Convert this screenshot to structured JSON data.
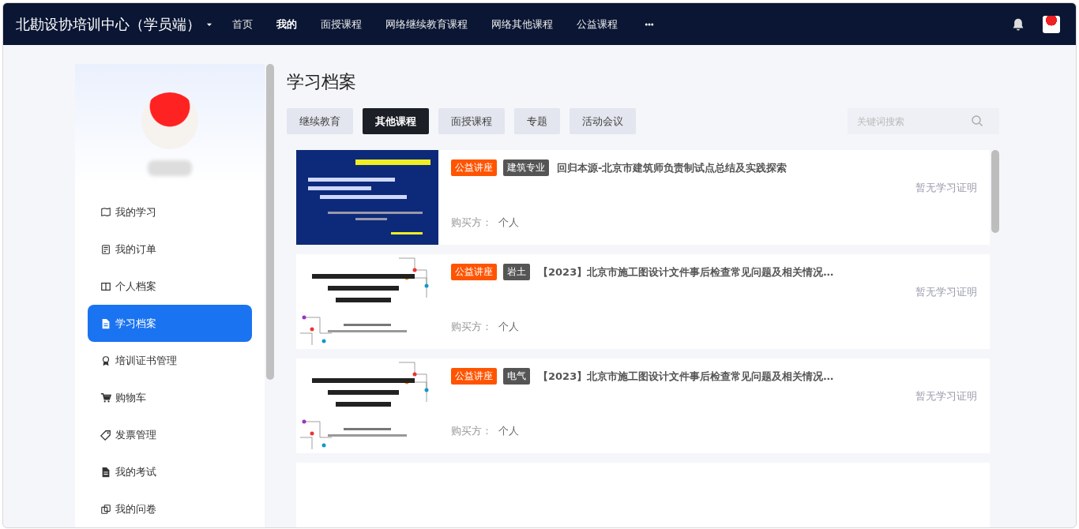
{
  "header": {
    "title": "北勘设协培训中心（学员端）",
    "nav": [
      {
        "label": "首页",
        "selected": false
      },
      {
        "label": "我的",
        "selected": true
      },
      {
        "label": "面授课程",
        "selected": false
      },
      {
        "label": "网络继续教育课程",
        "selected": false
      },
      {
        "label": "网络其他课程",
        "selected": false
      },
      {
        "label": "公益课程",
        "selected": false
      }
    ]
  },
  "sidebar": {
    "items": [
      {
        "label": "我的学习",
        "kind": "map",
        "selected": false
      },
      {
        "label": "我的订单",
        "kind": "order",
        "selected": false
      },
      {
        "label": "个人档案",
        "kind": "book",
        "selected": false
      },
      {
        "label": "学习档案",
        "kind": "file",
        "selected": true
      },
      {
        "label": "培训证书管理",
        "kind": "award",
        "selected": false
      },
      {
        "label": "购物车",
        "kind": "cart",
        "selected": false
      },
      {
        "label": "发票管理",
        "kind": "ticket",
        "selected": false
      },
      {
        "label": "我的考试",
        "kind": "file",
        "selected": false
      },
      {
        "label": "我的问卷",
        "kind": "copy",
        "selected": false
      }
    ]
  },
  "main": {
    "title": "学习档案",
    "tabs": [
      {
        "label": "继续教育",
        "selected": false
      },
      {
        "label": "其他课程",
        "selected": true
      },
      {
        "label": "面授课程",
        "selected": false
      },
      {
        "label": "专题",
        "selected": false
      },
      {
        "label": "活动会议",
        "selected": false
      }
    ],
    "search": {
      "placeholder": "关键词搜索"
    },
    "records": [
      {
        "tags": [
          {
            "label": "公益讲座",
            "color": "#ff5400"
          },
          {
            "label": "建筑专业",
            "color": "#555555"
          }
        ],
        "title": "回归本源-北京市建筑师负责制试点总结及实践探索",
        "certificate": "暂无学习证明",
        "buyer_label": "购买方：",
        "buyer": "个人"
      },
      {
        "tags": [
          {
            "label": "公益讲座",
            "color": "#ff5400"
          },
          {
            "label": "岩土",
            "color": "#555555"
          }
        ],
        "title": "【2023】北京市施工图设计文件事后检查常见问题及相关情况…",
        "certificate": "暂无学习证明",
        "buyer_label": "购买方：",
        "buyer": "个人"
      },
      {
        "tags": [
          {
            "label": "公益讲座",
            "color": "#ff5400"
          },
          {
            "label": "电气",
            "color": "#555555"
          }
        ],
        "title": "【2023】北京市施工图设计文件事后检查常见问题及相关情况…",
        "certificate": "暂无学习证明",
        "buyer_label": "购买方：",
        "buyer": "个人"
      }
    ]
  }
}
